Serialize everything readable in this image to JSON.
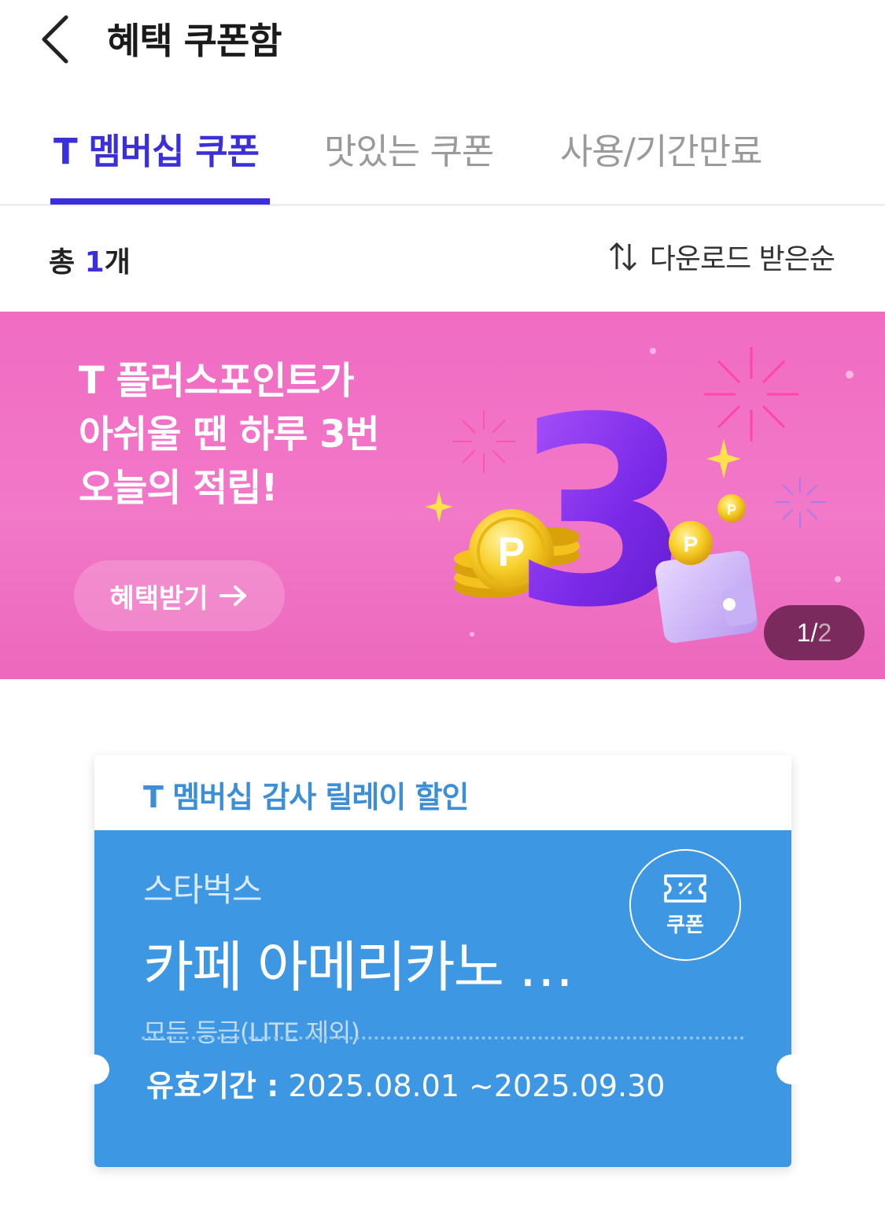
{
  "header": {
    "title": "혜택 쿠폰함"
  },
  "tabs": [
    {
      "label": "T 멤버십 쿠폰"
    },
    {
      "label": "맛있는 쿠폰"
    },
    {
      "label": "사용/기간만료"
    }
  ],
  "summary": {
    "count_prefix": "총 ",
    "count_value": "1",
    "count_suffix": "개",
    "sort_label": "다운로드 받은순"
  },
  "banner": {
    "lines": [
      "T 플러스포인트가",
      "아쉬울 땐 하루 3번",
      "오늘의 적립!"
    ],
    "button_label": "혜택받기",
    "pager_current": "1",
    "pager_sep": "/",
    "pager_total": "2",
    "art_number": "3",
    "coin_letter": "P"
  },
  "coupon": {
    "promo_title": "T 멤버십 감사 릴레이 할인",
    "brand": "스타벅스",
    "product": "카페 아메리카노 …",
    "grade": "모든 등급(LITE 제외)",
    "badge_label": "쿠폰",
    "validity_label": "유효기간 :",
    "validity_value": " 2025.08.01 ~2025.09.30"
  },
  "colors": {
    "accent": "#3b2fd9",
    "banner": "#f278c8",
    "coupon": "#3d97e2",
    "promo": "#3c8fd6"
  }
}
